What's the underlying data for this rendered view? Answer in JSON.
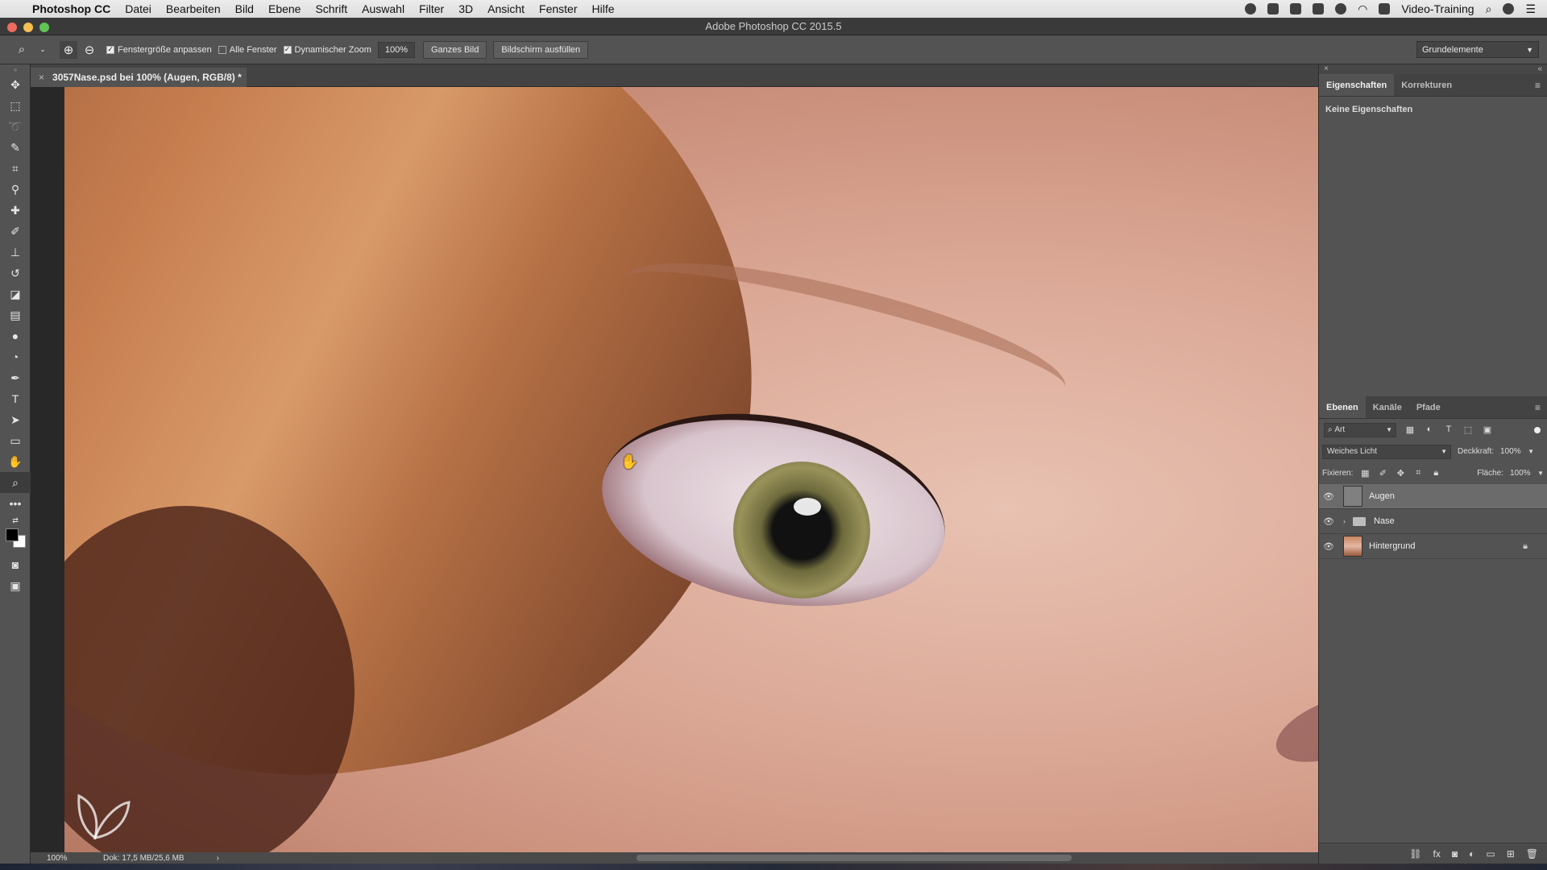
{
  "menubar": {
    "app_name": "Photoshop CC",
    "menus": [
      "Datei",
      "Bearbeiten",
      "Bild",
      "Ebene",
      "Schrift",
      "Auswahl",
      "Filter",
      "3D",
      "Ansicht",
      "Fenster",
      "Hilfe"
    ],
    "user": "Video-Training"
  },
  "window": {
    "title": "Adobe Photoshop CC 2015.5"
  },
  "options": {
    "resize_windows_label": "Fenstergröße anpassen",
    "resize_windows_checked": true,
    "all_windows_label": "Alle Fenster",
    "all_windows_checked": false,
    "scrubby_zoom_label": "Dynamischer Zoom",
    "scrubby_zoom_checked": true,
    "zoom_value": "100%",
    "fit_screen_label": "Ganzes Bild",
    "fill_screen_label": "Bildschirm ausfüllen",
    "workspace": "Grundelemente"
  },
  "document": {
    "tab_title": "3057Nase.psd bei 100% (Augen, RGB/8) *"
  },
  "status": {
    "zoom": "100%",
    "doc_size": "Dok: 17,5 MB/25,6 MB"
  },
  "properties_panel": {
    "tabs": [
      "Eigenschaften",
      "Korrekturen"
    ],
    "active_tab": 0,
    "empty_message": "Keine Eigenschaften"
  },
  "layers_panel": {
    "tabs": [
      "Ebenen",
      "Kanäle",
      "Pfade"
    ],
    "filter_kind": "Art",
    "blend_mode": "Weiches Licht",
    "opacity_label": "Deckkraft:",
    "opacity_value": "100%",
    "lock_label": "Fixieren:",
    "fill_label": "Fläche:",
    "fill_value": "100%",
    "layers": [
      {
        "name": "Augen",
        "type": "layer",
        "visible": true,
        "selected": true
      },
      {
        "name": "Nase",
        "type": "group",
        "visible": true,
        "selected": false
      },
      {
        "name": "Hintergrund",
        "type": "background",
        "visible": true,
        "selected": false,
        "locked": true
      }
    ]
  },
  "colors": {
    "ui_panel": "#535353",
    "ui_dark": "#434343",
    "selected_layer": "#6b6b6b"
  }
}
